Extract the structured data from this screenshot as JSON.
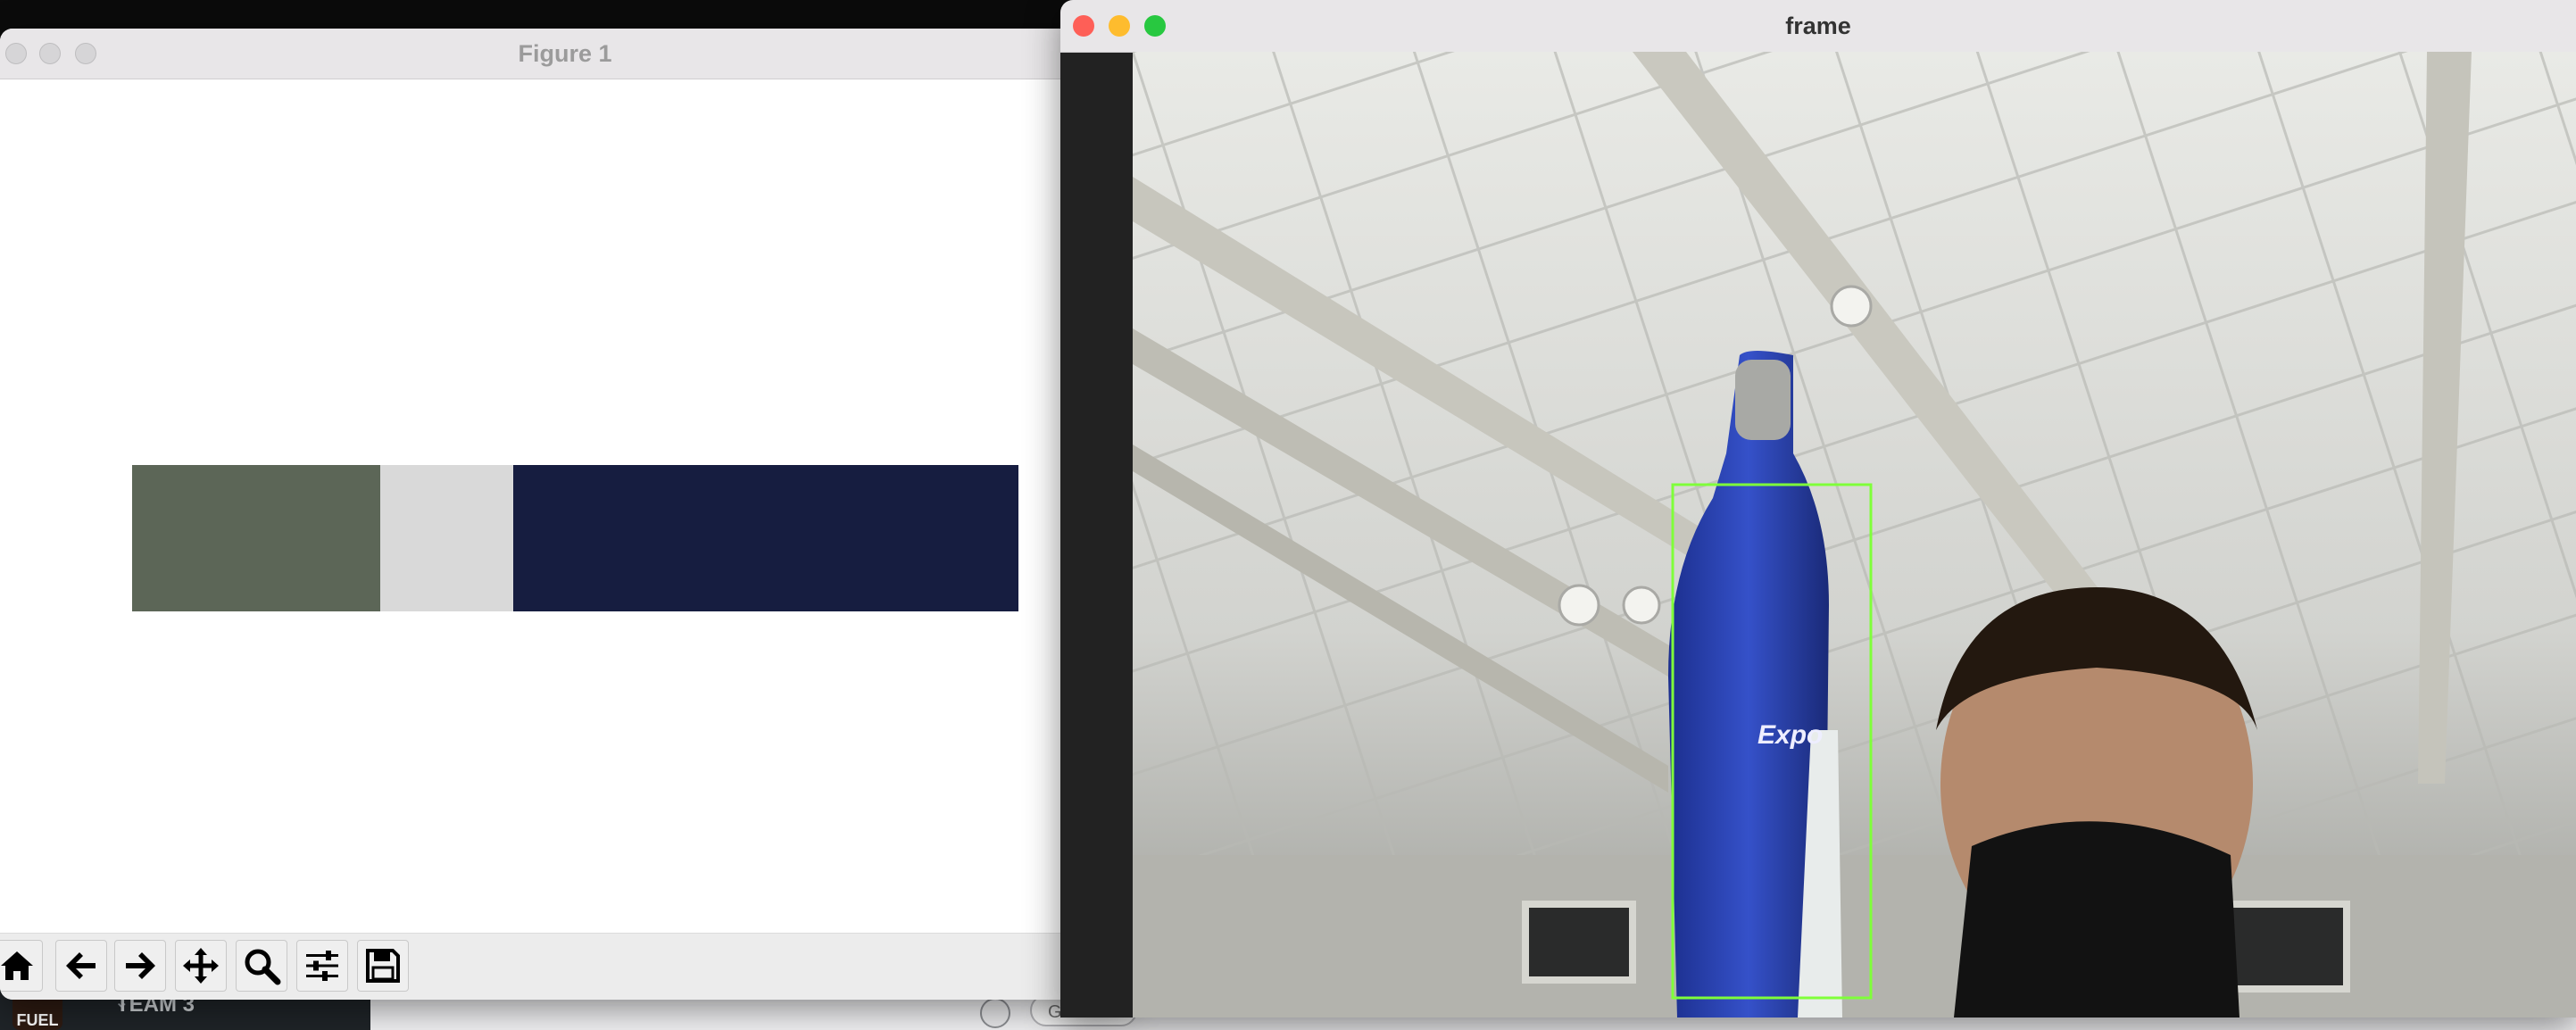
{
  "background": {
    "team_label": "TEAM 3",
    "logo_text": "FUEL",
    "search_partial": "Ga"
  },
  "figure_window": {
    "title": "Figure 1",
    "color_bar": {
      "segments": [
        {
          "color": "#5c6657",
          "fraction": 0.28
        },
        {
          "color": "#d9d9d9",
          "fraction": 0.15
        },
        {
          "color": "#161d40",
          "fraction": 0.57
        }
      ]
    },
    "toolbar": {
      "buttons": [
        {
          "name": "home-icon"
        },
        {
          "name": "back-arrow-icon"
        },
        {
          "name": "forward-arrow-icon"
        },
        {
          "name": "pan-move-icon"
        },
        {
          "name": "zoom-icon"
        },
        {
          "name": "subplots-config-icon"
        },
        {
          "name": "save-icon"
        }
      ]
    }
  },
  "frame_window": {
    "title": "frame",
    "traffic_lights": {
      "close": "#fe5f57",
      "minimize": "#febc2e",
      "maximize": "#28c840"
    },
    "bounding_box_color": "#7fff3a",
    "bottle_label": "Expo"
  }
}
